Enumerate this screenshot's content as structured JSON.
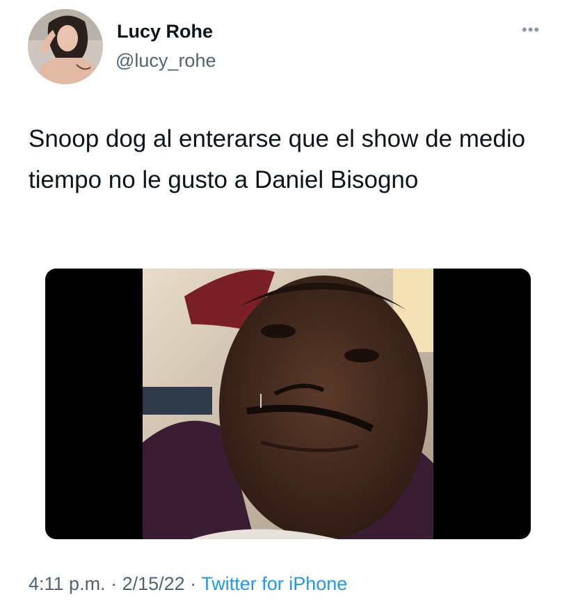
{
  "author": {
    "display_name": "Lucy Rohe",
    "handle": "@lucy_rohe",
    "avatar_icon": "profile-photo"
  },
  "more_icon": "more-horizontal-icon",
  "tweet": {
    "text": "Snoop dog al enterarse que el show de medio tiempo no le gusto a Daniel Bisogno"
  },
  "media": {
    "kind": "image",
    "description_icon": "crying-man-photo"
  },
  "meta": {
    "time": "4:11 p.m.",
    "separator": "·",
    "date": "2/15/22",
    "source": "Twitter for iPhone"
  },
  "colors": {
    "text_primary": "#0f1419",
    "text_secondary": "#536471",
    "link": "#1d9bf0"
  }
}
